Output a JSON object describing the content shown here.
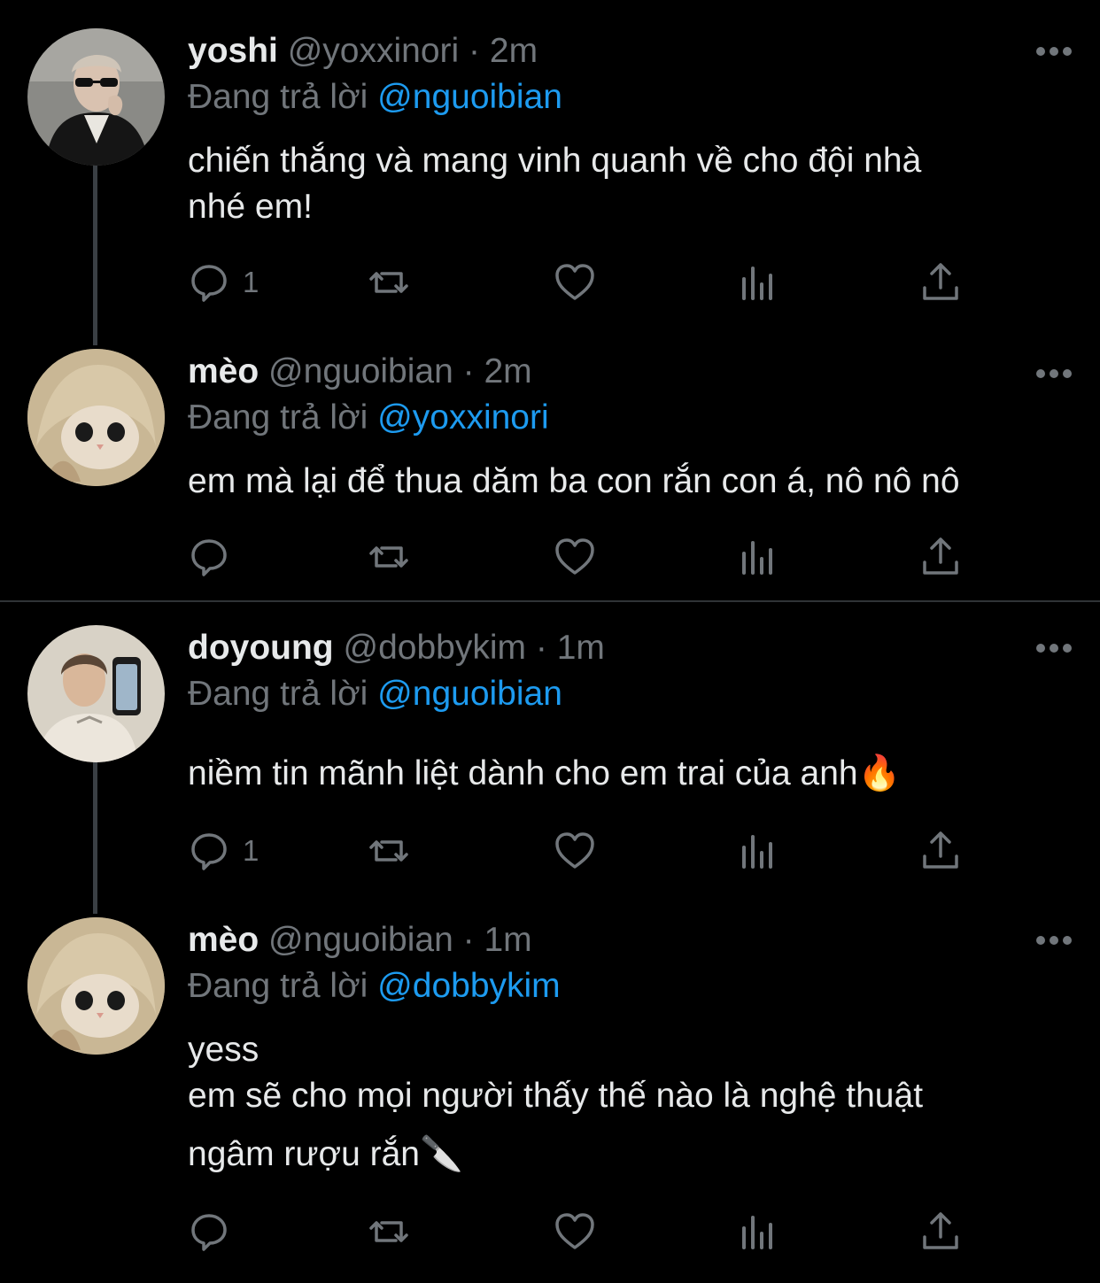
{
  "tweets": [
    {
      "name": "yoshi",
      "handle": "@yoxxinori",
      "dot": "·",
      "time": "2m",
      "reply_prefix": "Đang trả lời",
      "reply_to": "@nguoibian",
      "lines": [
        "chiến thắng và mang vinh quanh về cho đội nhà",
        "nhé em!"
      ],
      "reply_count": "1"
    },
    {
      "name": "mèo",
      "handle": "@nguoibian",
      "dot": "·",
      "time": "2m",
      "reply_prefix": "Đang trả lời",
      "reply_to": "@yoxxinori",
      "lines": [
        "em mà lại để thua dăm ba con rắn con á, nô nô nô"
      ],
      "reply_count": ""
    },
    {
      "name": "doyoung",
      "handle": "@dobbykim",
      "dot": "·",
      "time": "1m",
      "reply_prefix": "Đang trả lời",
      "reply_to": "@nguoibian",
      "lines": [
        "niềm tin mãnh liệt dành cho em trai của anh🔥"
      ],
      "reply_count": "1"
    },
    {
      "name": "mèo",
      "handle": "@nguoibian",
      "dot": "·",
      "time": "1m",
      "reply_prefix": "Đang trả lời",
      "reply_to": "@dobbykim",
      "lines": [
        "yess",
        "em sẽ cho mọi người thấy thế nào là nghệ thuật",
        "ngâm rượu rắn🔪"
      ],
      "reply_count": ""
    }
  ],
  "icons": {
    "reply": "reply-icon",
    "retweet": "retweet-icon",
    "like": "heart-icon",
    "views": "views-icon",
    "share": "share-icon",
    "more": "more-icon"
  },
  "colors": {
    "background": "#000000",
    "text": "#e7e9ea",
    "muted": "#71767b",
    "mention": "#1d9bf0"
  }
}
